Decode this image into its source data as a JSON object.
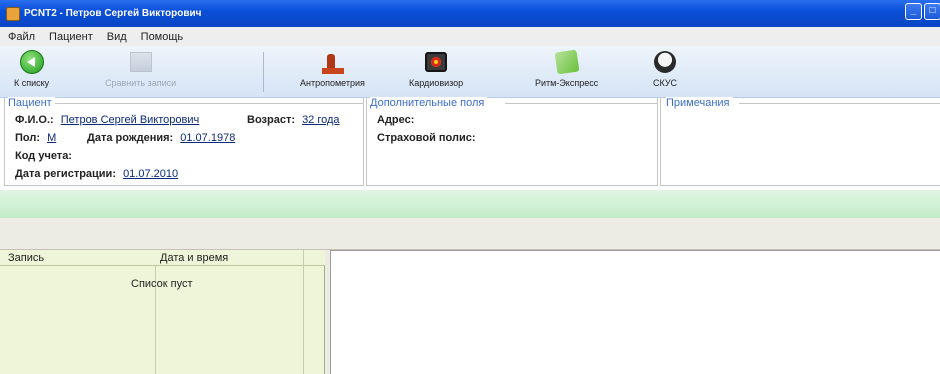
{
  "window": {
    "title": "PCNT2 - Петров Сергей Викторович",
    "min_glyph": "_",
    "max_glyph": "□"
  },
  "menu": [
    "Файл",
    "Пациент",
    "Вид",
    "Помощь"
  ],
  "toolbar": {
    "back_label": "К списку",
    "compare_label": "Сравнить записи",
    "anthropometry_label": "Антропометрия",
    "cardiovisor_label": "Кардиовизор",
    "rhythm_label": "Ритм-Экспресс",
    "skus_label": "СКУС"
  },
  "patient": {
    "group_title": "Пациент",
    "fio_label": "Ф.И.О.:",
    "fio_value": "Петров Сергей Викторович",
    "age_label": "Возраст:",
    "age_value": "32 года",
    "sex_label": "Пол:",
    "sex_value": "М",
    "dob_label": "Дата рождения:",
    "dob_value": "01.07.1978",
    "account_label": "Код учета:",
    "reg_label": "Дата регистрации:",
    "reg_value": "01.07.2010"
  },
  "extra": {
    "group_title": "Дополнительные поля",
    "address_label": "Адрес:",
    "insurance_label": "Страховой полис:"
  },
  "notes": {
    "group_title": "Примечания"
  },
  "records": {
    "col_record": "Запись",
    "col_datetime": "Дата и время",
    "empty_text": "Список пуст"
  },
  "colors": {
    "titlebar": "#0a4fd8",
    "group_title": "#3b6fcb",
    "records_bg": "#eef5d8",
    "green_band": "#c3ecc9"
  }
}
